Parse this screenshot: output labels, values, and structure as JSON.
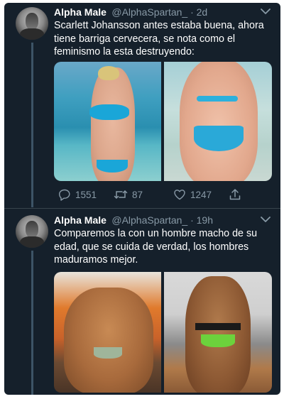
{
  "tweets": [
    {
      "name": "Alpha Male",
      "handle": "@AlphaSpartan_ · 2d",
      "text": "Scarlett Johansson antes estaba buena, ahora tiene barriga cervecera, se nota como el feminismo la esta destruyendo:",
      "actions": {
        "replies": "1551",
        "retweets": "87",
        "likes": "1247"
      }
    },
    {
      "name": "Alpha Male",
      "handle": "@AlphaSpartan_ · 19h",
      "text": "Comparemos la con un hombre macho de su edad, que se cuida de verdad, los hombres maduramos mejor."
    }
  ],
  "colors": {
    "background": "#15202b",
    "text_primary": "#ffffff",
    "text_secondary": "#8899a6",
    "thread_line": "#3d5466"
  },
  "icons": [
    "reply-icon",
    "retweet-icon",
    "like-icon",
    "share-icon",
    "chevron-down-icon"
  ]
}
